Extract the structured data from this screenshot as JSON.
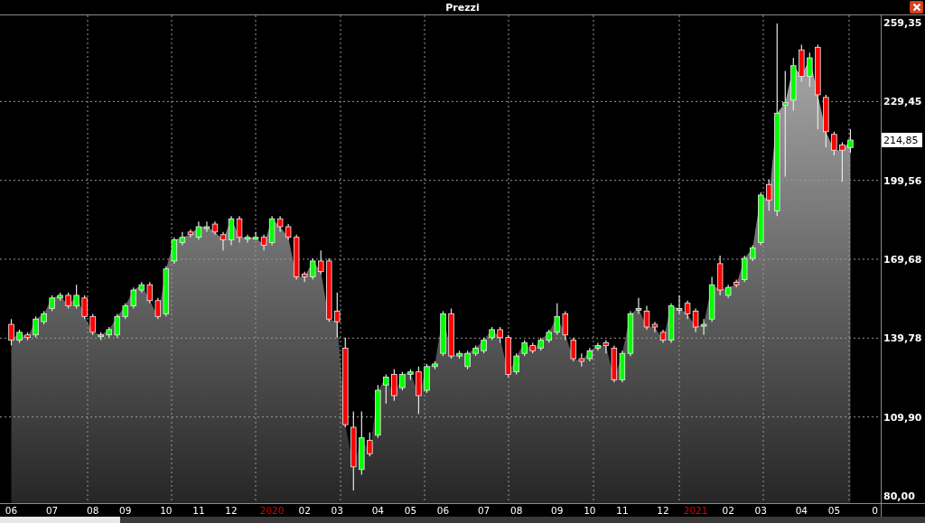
{
  "window": {
    "title": "Prezzi"
  },
  "chart": {
    "chart_data": {
      "type": "candlestick",
      "categories": [
        "06",
        null,
        null,
        null,
        null,
        "07",
        null,
        null,
        null,
        null,
        "08",
        null,
        null,
        null,
        "09",
        null,
        null,
        null,
        null,
        "10",
        null,
        null,
        null,
        "11",
        null,
        null,
        null,
        "12",
        null,
        null,
        null,
        null,
        "2020",
        null,
        null,
        null,
        "02",
        null,
        null,
        null,
        "03",
        null,
        null,
        null,
        null,
        "04",
        null,
        null,
        null,
        "05",
        null,
        null,
        null,
        "06",
        null,
        null,
        null,
        null,
        "07",
        null,
        null,
        null,
        "08",
        null,
        null,
        null,
        null,
        "09",
        null,
        null,
        null,
        "10",
        null,
        null,
        null,
        "11",
        null,
        null,
        null,
        null,
        "12",
        null,
        null,
        null,
        "2021",
        null,
        null,
        null,
        "02",
        null,
        null,
        null,
        "03",
        null,
        null,
        null,
        null,
        "04",
        null,
        null,
        null,
        "05",
        null,
        null,
        null,
        null,
        "0"
      ],
      "ohlc": [
        [
          145,
          147,
          137,
          139
        ],
        [
          139,
          143,
          138,
          142
        ],
        [
          141,
          142,
          139,
          140
        ],
        [
          141,
          148,
          140,
          147
        ],
        [
          146,
          150,
          145,
          149
        ],
        [
          151,
          156,
          150,
          155
        ],
        [
          155,
          157,
          154,
          156
        ],
        [
          156,
          157,
          151,
          152
        ],
        [
          152,
          160,
          151,
          156
        ],
        [
          155,
          156,
          147,
          148
        ],
        [
          148,
          149,
          141,
          142
        ],
        [
          141,
          142,
          139,
          141
        ],
        [
          141,
          144,
          140,
          143
        ],
        [
          141,
          149,
          140,
          148
        ],
        [
          148,
          153,
          147,
          152
        ],
        [
          152,
          159,
          151,
          158
        ],
        [
          158,
          161,
          157,
          160
        ],
        [
          160,
          161,
          153,
          154
        ],
        [
          154,
          155,
          147,
          148
        ],
        [
          149,
          167,
          148,
          166
        ],
        [
          169,
          178,
          168,
          177
        ],
        [
          176,
          180,
          175,
          178
        ],
        [
          180,
          181,
          178,
          179
        ],
        [
          178,
          184,
          177,
          182
        ],
        [
          182,
          184,
          180,
          182
        ],
        [
          183,
          184,
          179,
          180
        ],
        [
          179,
          180,
          173,
          177
        ],
        [
          177,
          186,
          175,
          185
        ],
        [
          185,
          186,
          176,
          178
        ],
        [
          178,
          179,
          176,
          178
        ],
        [
          178,
          180,
          177,
          178
        ],
        [
          178,
          179,
          173,
          175
        ],
        [
          176,
          186,
          175,
          185
        ],
        [
          185,
          186,
          180,
          182
        ],
        [
          182,
          183,
          177,
          178
        ],
        [
          178,
          179,
          162,
          163
        ],
        [
          164,
          165,
          161,
          163
        ],
        [
          163,
          170,
          162,
          169
        ],
        [
          169,
          173,
          164,
          165
        ],
        [
          169,
          170,
          146,
          147
        ],
        [
          150,
          157,
          140,
          146
        ],
        [
          136,
          140,
          106,
          107
        ],
        [
          106,
          112,
          82,
          91
        ],
        [
          90,
          112,
          88,
          102
        ],
        [
          101,
          104,
          95,
          96
        ],
        [
          103,
          122,
          102,
          120
        ],
        [
          122,
          126,
          115,
          125
        ],
        [
          126,
          128,
          116,
          118
        ],
        [
          121,
          127,
          120,
          126
        ],
        [
          126,
          128,
          124,
          127
        ],
        [
          127,
          129,
          111,
          118
        ],
        [
          120,
          130,
          119,
          129
        ],
        [
          129,
          131,
          128,
          130
        ],
        [
          134,
          150,
          133,
          149
        ],
        [
          149,
          151,
          132,
          133
        ],
        [
          133,
          135,
          132,
          134
        ],
        [
          129,
          135,
          128,
          134
        ],
        [
          134,
          137,
          133,
          136
        ],
        [
          135,
          140,
          134,
          139
        ],
        [
          140,
          144,
          139,
          143
        ],
        [
          143,
          144,
          138,
          140
        ],
        [
          140,
          141,
          125,
          126
        ],
        [
          127,
          134,
          126,
          133
        ],
        [
          134,
          139,
          133,
          138
        ],
        [
          137,
          138,
          134,
          135
        ],
        [
          136,
          140,
          135,
          139
        ],
        [
          139,
          143,
          138,
          142
        ],
        [
          142,
          153,
          141,
          148
        ],
        [
          149,
          150,
          139,
          141
        ],
        [
          139,
          140,
          131,
          132
        ],
        [
          132,
          134,
          129,
          131
        ],
        [
          132,
          136,
          131,
          135
        ],
        [
          136,
          138,
          135,
          137
        ],
        [
          138,
          139,
          134,
          137
        ],
        [
          136,
          137,
          123,
          124
        ],
        [
          124,
          135,
          123,
          134
        ],
        [
          134,
          150,
          133,
          149
        ],
        [
          151,
          155,
          149,
          151
        ],
        [
          150,
          152,
          143,
          144
        ],
        [
          145,
          146,
          142,
          144
        ],
        [
          142,
          143,
          138,
          139
        ],
        [
          139,
          153,
          138,
          152
        ],
        [
          151,
          156,
          149,
          151
        ],
        [
          153,
          154,
          147,
          149
        ],
        [
          150,
          151,
          142,
          144
        ],
        [
          145,
          147,
          141,
          145
        ],
        [
          147,
          163,
          146,
          160
        ],
        [
          168,
          171,
          156,
          158
        ],
        [
          156,
          160,
          155,
          159
        ],
        [
          161,
          162,
          159,
          160
        ],
        [
          162,
          171,
          161,
          170
        ],
        [
          170,
          175,
          169,
          174
        ],
        [
          176,
          195,
          175,
          194
        ],
        [
          198,
          200,
          188,
          192
        ],
        [
          188,
          259,
          186,
          225
        ],
        [
          228,
          241,
          201,
          229
        ],
        [
          230,
          246,
          226,
          243
        ],
        [
          249,
          251,
          237,
          239
        ],
        [
          239,
          248,
          235,
          246
        ],
        [
          250,
          251,
          219,
          232
        ],
        [
          231,
          232,
          212,
          218
        ],
        [
          217,
          218,
          209,
          211
        ],
        [
          213,
          214,
          199,
          211
        ],
        [
          212,
          219,
          210,
          214.85
        ],
        null,
        null,
        null
      ],
      "series": [
        {
          "type": "area",
          "color": "#9d9d9d",
          "values": [
            139,
            142,
            140,
            147,
            149,
            155,
            156,
            152,
            156,
            148,
            142,
            141,
            143,
            148,
            152,
            158,
            160,
            154,
            148,
            166,
            177,
            178,
            179,
            182,
            182,
            180,
            177,
            185,
            178,
            178,
            178,
            175,
            185,
            182,
            178,
            163,
            163,
            169,
            165,
            147,
            146,
            107,
            91,
            102,
            96,
            120,
            125,
            118,
            126,
            127,
            118,
            129,
            130,
            149,
            133,
            134,
            134,
            136,
            139,
            143,
            140,
            126,
            133,
            138,
            135,
            139,
            142,
            148,
            141,
            132,
            131,
            135,
            137,
            137,
            124,
            134,
            149,
            151,
            144,
            144,
            139,
            152,
            151,
            149,
            144,
            145,
            160,
            158,
            159,
            160,
            170,
            174,
            194,
            192,
            225,
            229,
            243,
            239,
            246,
            232,
            218,
            211,
            211,
            214.85,
            null,
            null,
            null
          ]
        }
      ],
      "ylim": [
        77.25,
        262.09
      ],
      "grid": true,
      "yticks": [
        {
          "value": 80,
          "label": "80,00"
        },
        {
          "value": 109.9,
          "label": "109,90"
        },
        {
          "value": 139.78,
          "label": "139,78"
        },
        {
          "value": 169.68,
          "label": "169,68"
        },
        {
          "value": 199.56,
          "label": "199,56"
        },
        {
          "value": 229.45,
          "label": "229,45"
        },
        {
          "value": 259.35,
          "label": "259,35"
        }
      ],
      "annotations": [
        "214,85"
      ]
    }
  }
}
